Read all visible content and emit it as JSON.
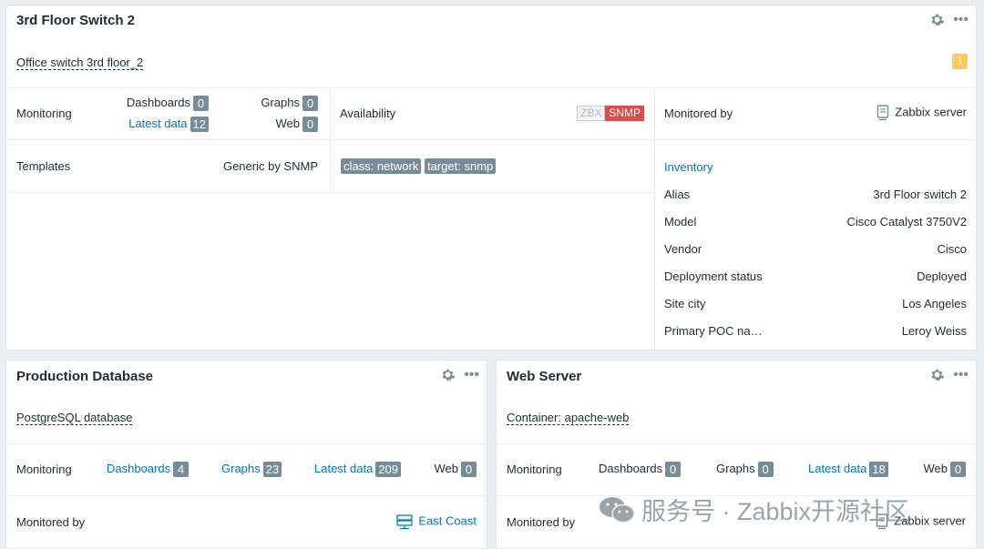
{
  "widgets": {
    "switch": {
      "title": "3rd Floor Switch 2",
      "description": "Office switch 3rd floor_2",
      "problems_count": "1",
      "monitoring": {
        "label": "Monitoring",
        "dashboards_label": "Dashboards",
        "dashboards_count": "0",
        "latest_data_label": "Latest data",
        "latest_data_count": "12",
        "graphs_label": "Graphs",
        "graphs_count": "0",
        "web_label": "Web",
        "web_count": "0"
      },
      "availability": {
        "label": "Availability",
        "zbx": "ZBX",
        "snmp": "SNMP"
      },
      "monitored_by": {
        "label": "Monitored by",
        "value": "Zabbix server"
      },
      "templates": {
        "label": "Templates",
        "value": "Generic by SNMP"
      },
      "tags": [
        "class: network",
        "target: snmp"
      ],
      "inventory": {
        "label": "Inventory",
        "fields": [
          {
            "name": "Alias",
            "value": "3rd Floor switch 2"
          },
          {
            "name": "Model",
            "value": "Cisco Catalyst 3750V2"
          },
          {
            "name": "Vendor",
            "value": "Cisco"
          },
          {
            "name": "Deployment status",
            "value": "Deployed"
          },
          {
            "name": "Site city",
            "value": "Los Angeles"
          },
          {
            "name": "Primary POC na…",
            "value": "Leroy Weiss"
          }
        ]
      }
    },
    "database": {
      "title": "Production Database",
      "description": "PostgreSQL database",
      "monitoring": {
        "label": "Monitoring",
        "dashboards_label": "Dashboards",
        "dashboards_count": "4",
        "graphs_label": "Graphs",
        "graphs_count": "23",
        "latest_data_label": "Latest data",
        "latest_data_count": "209",
        "web_label": "Web",
        "web_count": "0"
      },
      "monitored_by": {
        "label": "Monitored by",
        "value": "East Coast"
      }
    },
    "webserver": {
      "title": "Web Server",
      "description": "Container: apache-web",
      "monitoring": {
        "label": "Monitoring",
        "dashboards_label": "Dashboards",
        "dashboards_count": "0",
        "graphs_label": "Graphs",
        "graphs_count": "0",
        "latest_data_label": "Latest data",
        "latest_data_count": "18",
        "web_label": "Web",
        "web_count": "0"
      },
      "monitored_by": {
        "label": "Monitored by",
        "value": "Zabbix server"
      }
    }
  },
  "watermark": "服务号 · Zabbix开源社区",
  "colors": {
    "link": "#0275b8",
    "count_badge": "#768d99",
    "snmp_error": "#d64e4e",
    "warning": "#ffc859"
  }
}
